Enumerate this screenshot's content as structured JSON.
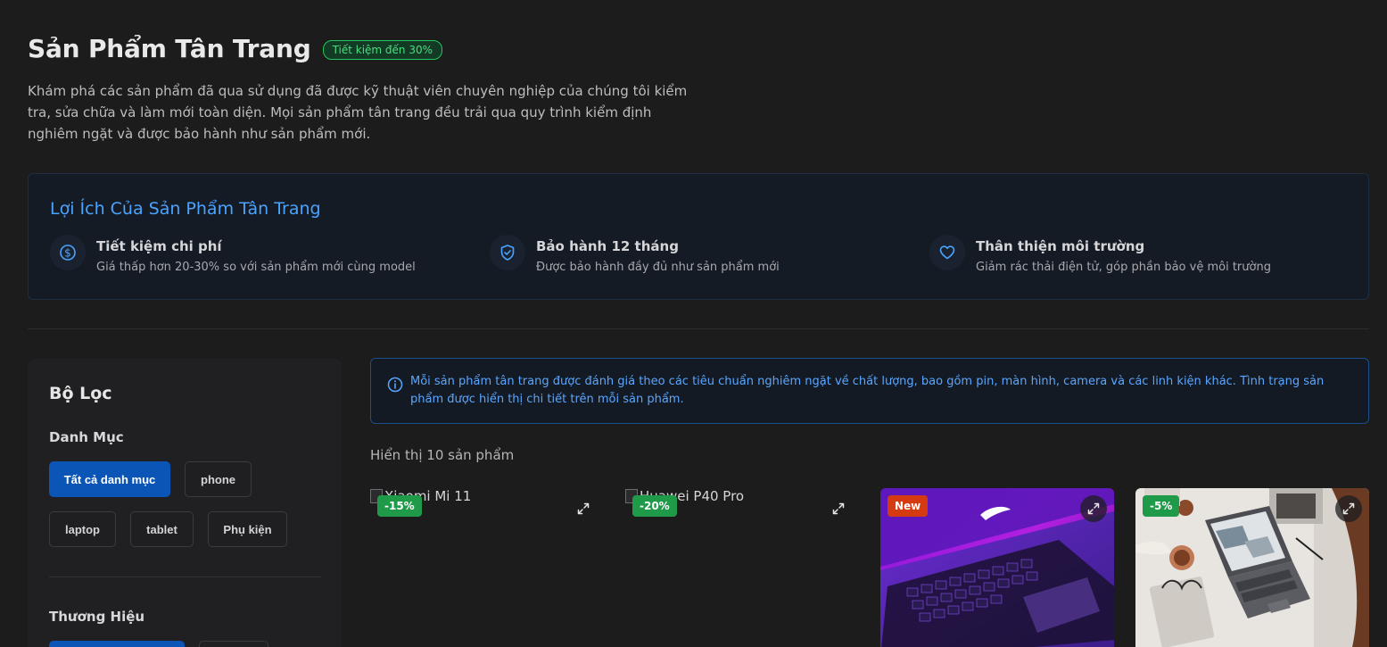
{
  "header": {
    "title": "Sản Phẩm Tân Trang",
    "badge": "Tiết kiệm đến 30%",
    "intro": "Khám phá các sản phẩm đã qua sử dụng đã được kỹ thuật viên chuyên nghiệp của chúng tôi kiểm tra, sửa chữa và làm mới toàn diện. Mọi sản phẩm tân trang đều trải qua quy trình kiểm định nghiêm ngặt và được bảo hành như sản phẩm mới."
  },
  "benefits": {
    "title": "Lợi Ích Của Sản Phẩm Tân Trang",
    "items": [
      {
        "icon": "dollar-icon",
        "title": "Tiết kiệm chi phí",
        "desc": "Giá thấp hơn 20-30% so với sản phẩm mới cùng model"
      },
      {
        "icon": "shield-check-icon",
        "title": "Bảo hành 12 tháng",
        "desc": "Được bảo hành đầy đủ như sản phẩm mới"
      },
      {
        "icon": "heart-icon",
        "title": "Thân thiện môi trường",
        "desc": "Giảm rác thải điện tử, góp phần bảo vệ môi trường"
      }
    ]
  },
  "filters": {
    "title": "Bộ Lọc",
    "category_label": "Danh Mục",
    "categories": [
      "Tất cả danh mục",
      "phone",
      "laptop",
      "tablet",
      "Phụ kiện"
    ],
    "brand_label": "Thương Hiệu"
  },
  "alert": {
    "text": "Mỗi sản phẩm tân trang được đánh giá theo các tiêu chuẩn nghiêm ngặt về chất lượng, bao gồm pin, màn hình, camera và các linh kiện khác. Tình trạng sản phẩm được hiển thị chi tiết trên mỗi sản phẩm."
  },
  "results": {
    "count_text": "Hiển thị 10 sản phẩm"
  },
  "products": [
    {
      "alt": "Xiaomi Mi 11",
      "badge": "-15%"
    },
    {
      "alt": "Huawei P40 Pro",
      "badge": "-20%"
    },
    {
      "alt": "",
      "badge": "New"
    },
    {
      "alt": "",
      "badge": "-5%"
    }
  ],
  "colors": {
    "background": "#1c1c1d",
    "accent": "#4aa3ff",
    "primary_button": "#0b55b7",
    "discount": "#1f9a48",
    "new": "#d63a10"
  }
}
